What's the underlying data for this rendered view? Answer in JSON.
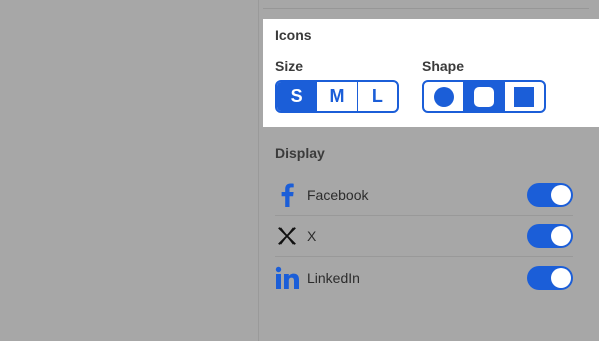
{
  "icons_panel": {
    "title": "Icons",
    "size": {
      "label": "Size",
      "options": [
        {
          "label": "S",
          "selected": true
        },
        {
          "label": "M",
          "selected": false
        },
        {
          "label": "L",
          "selected": false
        }
      ]
    },
    "shape": {
      "label": "Shape",
      "options": [
        {
          "icon": "circle-shape-icon",
          "selected": false
        },
        {
          "icon": "rounded-square-shape-icon",
          "selected": true
        },
        {
          "icon": "square-shape-icon",
          "selected": false
        }
      ]
    }
  },
  "display_panel": {
    "title": "Display",
    "items": [
      {
        "label": "Facebook",
        "icon": "facebook-icon",
        "enabled": true
      },
      {
        "label": "X",
        "icon": "x-icon",
        "enabled": true
      },
      {
        "label": "LinkedIn",
        "icon": "linkedin-icon",
        "enabled": true
      }
    ]
  },
  "colors": {
    "accent": "#1b5ed8",
    "facebook": "#1b5ed8",
    "linkedin": "#1b5ed8",
    "background_overlay": "#a7a7a7"
  }
}
